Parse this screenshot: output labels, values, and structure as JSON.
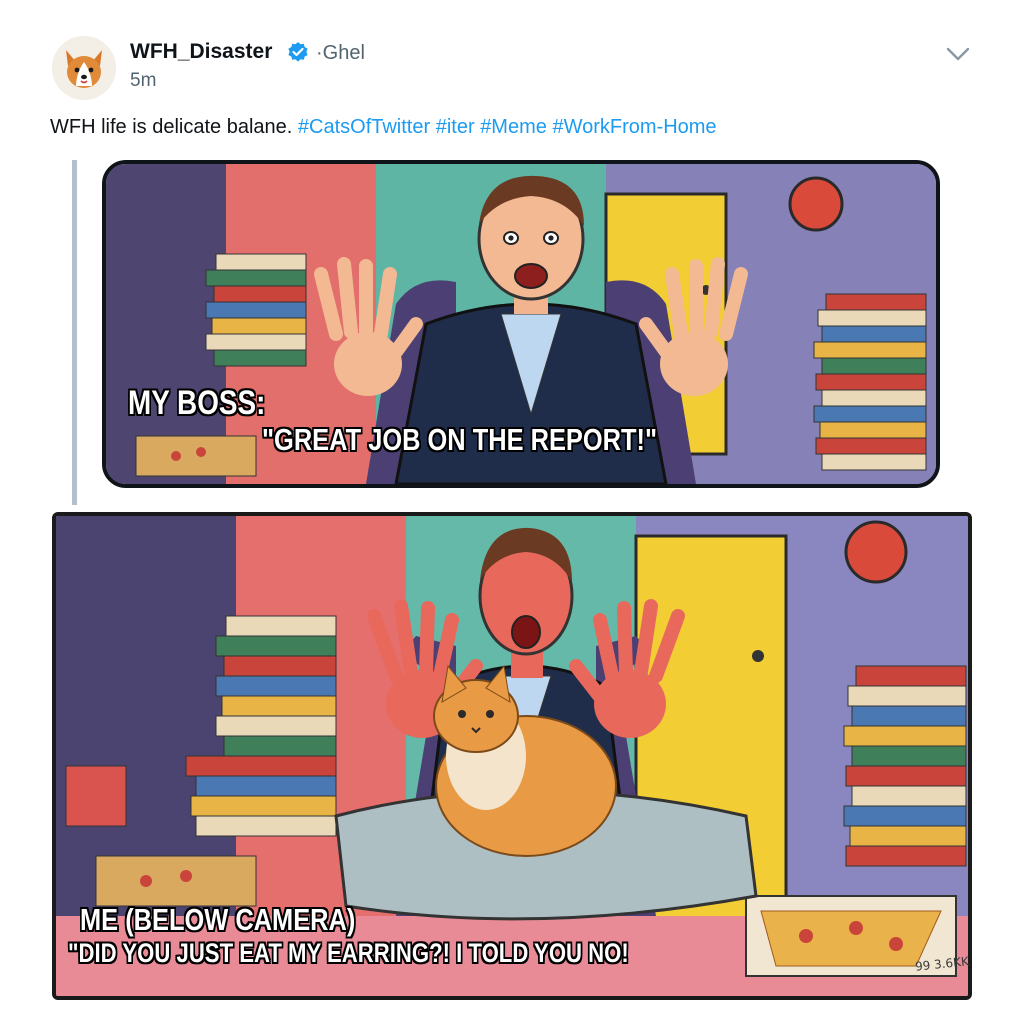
{
  "post": {
    "display_name": "WFH_Disaster",
    "handle": "·Ghel",
    "time": "5m",
    "text_plain": "WFH life is delicate balane. ",
    "hashtags": [
      "#CatsOfTwitter",
      "#iter",
      "#Meme",
      "#WorkFrom-Home"
    ]
  },
  "icons": {
    "avatar": "corgi-avatar-icon",
    "verified": "verified-badge-icon",
    "menu": "chevron-down-icon"
  },
  "colors": {
    "link": "#1d9bf0",
    "verified": "#1d9bf0",
    "thread_line": "#b6c0cc"
  },
  "meme": {
    "panel_top": {
      "caption_label": "MY BOSS:",
      "caption_quote": "\"GREAT JOB ON THE REPORT!\""
    },
    "panel_bottom": {
      "caption_label": "ME (BELOW CAMERA)",
      "caption_quote": "\"DID YOU JUST EAT MY EARRING?! I TOLD YOU NO!",
      "signature": "99 3.6KK"
    }
  }
}
